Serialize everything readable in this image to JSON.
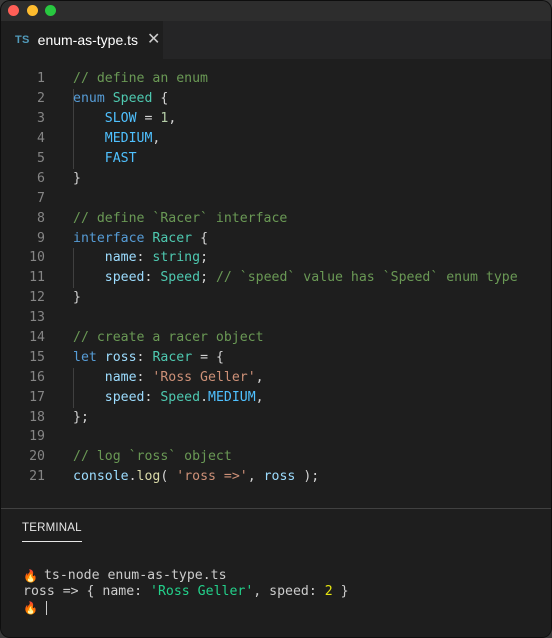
{
  "window": {
    "traffic_lights": [
      "close",
      "minimize",
      "zoom"
    ]
  },
  "tab": {
    "icon_label": "TS",
    "filename": "enum-as-type.ts",
    "close_glyph": "✕"
  },
  "editor": {
    "lines": [
      {
        "n": "1",
        "tokens": [
          [
            "com",
            "// define an enum"
          ]
        ]
      },
      {
        "n": "2",
        "tokens": [
          [
            "kw",
            "enum"
          ],
          [
            "plain",
            " "
          ],
          [
            "type",
            "Speed"
          ],
          [
            "plain",
            " {"
          ]
        ]
      },
      {
        "n": "3",
        "tokens": [
          [
            "plain",
            "    "
          ],
          [
            "const",
            "SLOW"
          ],
          [
            "plain",
            " = "
          ],
          [
            "num",
            "1"
          ],
          [
            "plain",
            ","
          ]
        ]
      },
      {
        "n": "4",
        "tokens": [
          [
            "plain",
            "    "
          ],
          [
            "const",
            "MEDIUM"
          ],
          [
            "plain",
            ","
          ]
        ]
      },
      {
        "n": "5",
        "tokens": [
          [
            "plain",
            "    "
          ],
          [
            "const",
            "FAST"
          ]
        ]
      },
      {
        "n": "6",
        "tokens": [
          [
            "plain",
            "}"
          ]
        ]
      },
      {
        "n": "7",
        "tokens": []
      },
      {
        "n": "8",
        "tokens": [
          [
            "com",
            "// define `Racer` interface"
          ]
        ]
      },
      {
        "n": "9",
        "tokens": [
          [
            "kw",
            "interface"
          ],
          [
            "plain",
            " "
          ],
          [
            "type",
            "Racer"
          ],
          [
            "plain",
            " {"
          ]
        ]
      },
      {
        "n": "10",
        "tokens": [
          [
            "plain",
            "    "
          ],
          [
            "prop",
            "name"
          ],
          [
            "plain",
            ": "
          ],
          [
            "type",
            "string"
          ],
          [
            "plain",
            ";"
          ]
        ]
      },
      {
        "n": "11",
        "tokens": [
          [
            "plain",
            "    "
          ],
          [
            "prop",
            "speed"
          ],
          [
            "plain",
            ": "
          ],
          [
            "type",
            "Speed"
          ],
          [
            "plain",
            "; "
          ],
          [
            "com",
            "// `speed` value has `Speed` enum type"
          ]
        ]
      },
      {
        "n": "12",
        "tokens": [
          [
            "plain",
            "}"
          ]
        ]
      },
      {
        "n": "13",
        "tokens": []
      },
      {
        "n": "14",
        "tokens": [
          [
            "com",
            "// create a racer object"
          ]
        ]
      },
      {
        "n": "15",
        "tokens": [
          [
            "kw",
            "let"
          ],
          [
            "plain",
            " "
          ],
          [
            "prop",
            "ross"
          ],
          [
            "plain",
            ": "
          ],
          [
            "type",
            "Racer"
          ],
          [
            "plain",
            " = {"
          ]
        ]
      },
      {
        "n": "16",
        "tokens": [
          [
            "plain",
            "    "
          ],
          [
            "prop",
            "name"
          ],
          [
            "plain",
            ": "
          ],
          [
            "str",
            "'Ross Geller'"
          ],
          [
            "plain",
            ","
          ]
        ]
      },
      {
        "n": "17",
        "tokens": [
          [
            "plain",
            "    "
          ],
          [
            "prop",
            "speed"
          ],
          [
            "plain",
            ": "
          ],
          [
            "type",
            "Speed"
          ],
          [
            "plain",
            "."
          ],
          [
            "const",
            "MEDIUM"
          ],
          [
            "plain",
            ","
          ]
        ]
      },
      {
        "n": "18",
        "tokens": [
          [
            "plain",
            "};"
          ]
        ]
      },
      {
        "n": "19",
        "tokens": []
      },
      {
        "n": "20",
        "tokens": [
          [
            "com",
            "// log `ross` object"
          ]
        ]
      },
      {
        "n": "21",
        "tokens": [
          [
            "prop",
            "console"
          ],
          [
            "plain",
            "."
          ],
          [
            "fn",
            "log"
          ],
          [
            "plain",
            "( "
          ],
          [
            "str",
            "'ross =>'"
          ],
          [
            "plain",
            ", "
          ],
          [
            "prop",
            "ross"
          ],
          [
            "plain",
            " );"
          ]
        ]
      }
    ]
  },
  "terminal": {
    "panel_title": "TERMINAL",
    "prompt_icon": "🔥",
    "command": "ts-node enum-as-type.ts",
    "output": {
      "prefix": "ross => { name: ",
      "name_value": "'Ross Geller'",
      "middle": ", speed: ",
      "speed_value": "2",
      "suffix": " }"
    }
  },
  "colors": {
    "background": "#1e1e1e",
    "comment": "#6a9955",
    "keyword": "#569cd6",
    "type": "#4ec9b0",
    "constant": "#4fc1ff",
    "property": "#9cdcfe",
    "number": "#b5cea8",
    "string": "#ce9178",
    "function": "#dcdcaa",
    "terminal_string": "#23d18b",
    "terminal_number": "#e5e510"
  }
}
